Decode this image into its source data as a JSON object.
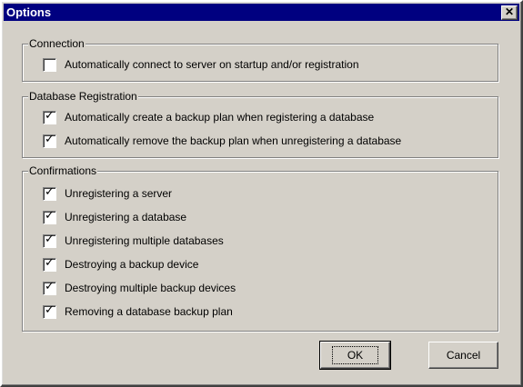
{
  "window": {
    "title": "Options",
    "close_glyph": "✕"
  },
  "groups": {
    "connection": {
      "label": "Connection",
      "items": [
        {
          "label": "Automatically connect to server on startup and/or registration",
          "checked": false
        }
      ]
    },
    "database_registration": {
      "label": "Database Registration",
      "items": [
        {
          "label": "Automatically create a backup plan when registering a database",
          "checked": true
        },
        {
          "label": "Automatically remove the backup plan when unregistering a database",
          "checked": true
        }
      ]
    },
    "confirmations": {
      "label": "Confirmations",
      "items": [
        {
          "label": "Unregistering a server",
          "checked": true
        },
        {
          "label": "Unregistering a database",
          "checked": true
        },
        {
          "label": "Unregistering multiple databases",
          "checked": true
        },
        {
          "label": "Destroying a backup device",
          "checked": true
        },
        {
          "label": "Destroying multiple backup devices",
          "checked": true
        },
        {
          "label": "Removing a database backup plan",
          "checked": true
        }
      ]
    }
  },
  "buttons": {
    "ok": "OK",
    "cancel": "Cancel"
  },
  "colors": {
    "face": "#d4d0c8",
    "title_bar": "#000080"
  },
  "check_glyph": "✓"
}
